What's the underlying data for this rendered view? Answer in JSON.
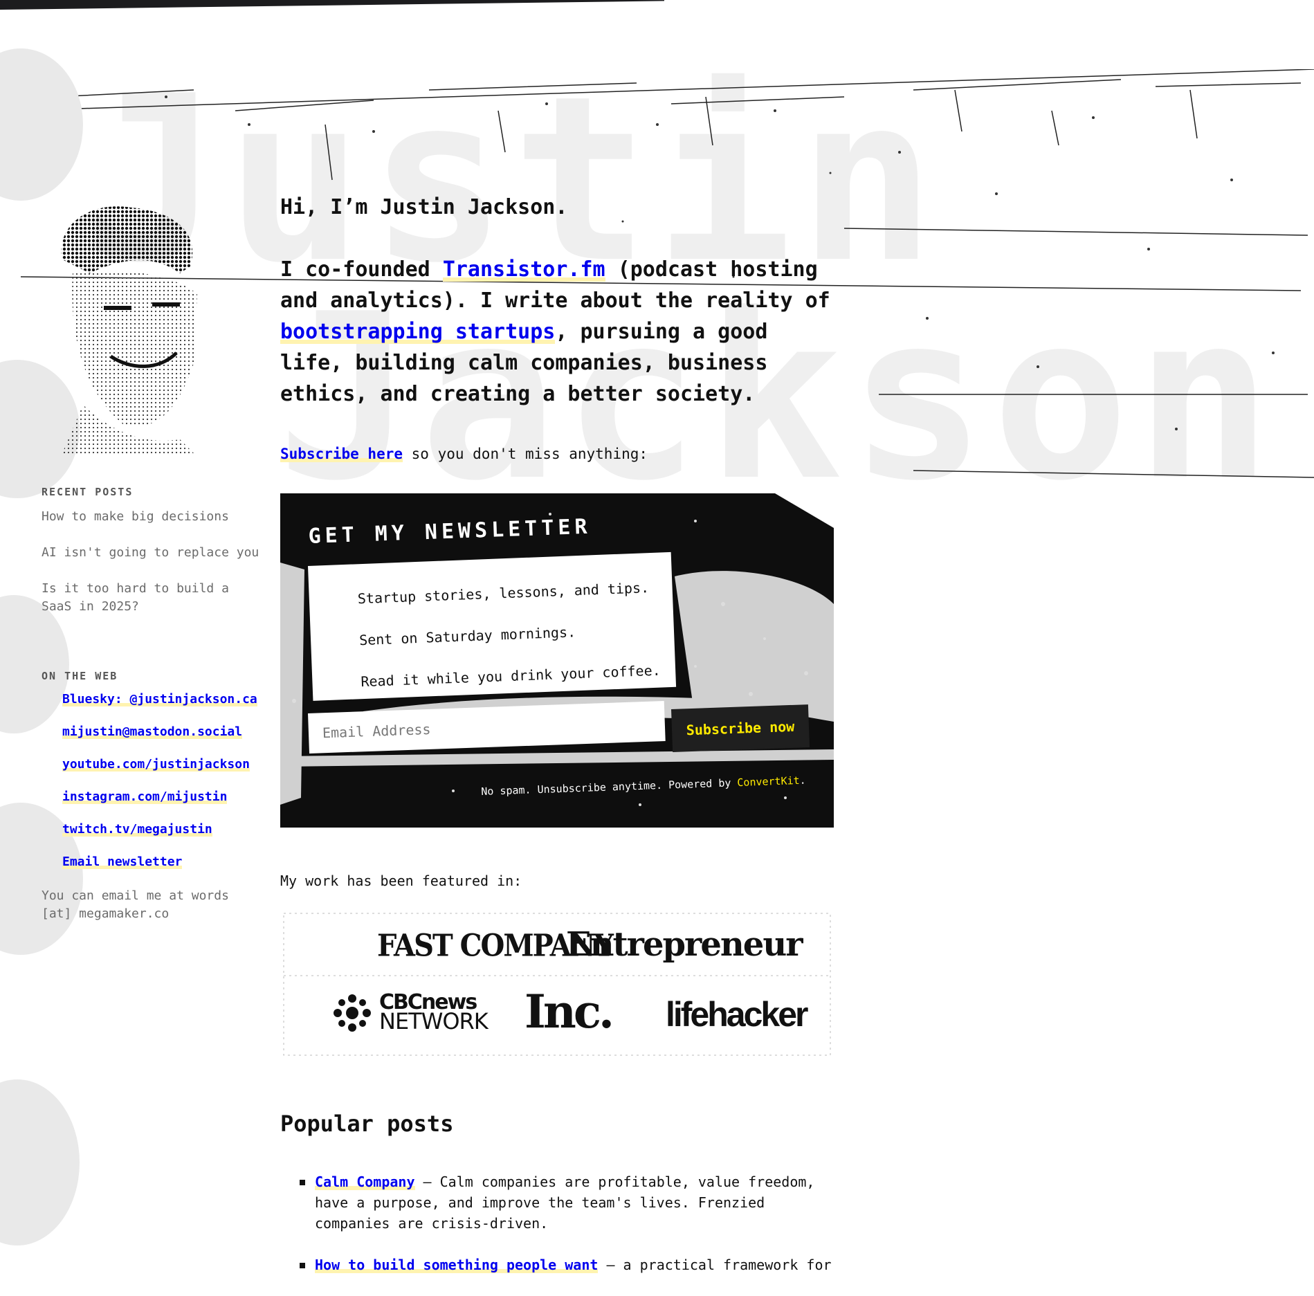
{
  "background_words": [
    "Justin",
    "Jackson"
  ],
  "hero": {
    "greeting": "Hi, I’m Justin Jackson.",
    "intro_prefix": "I co-founded ",
    "transistor_link": "Transistor.fm",
    "intro_middle": " (podcast hosting and analytics). I write about the reality of ",
    "bootstrapping_link": "bootstrapping startups",
    "intro_suffix": ", pursuing a good life, building calm companies, business ethics, and creating a better society."
  },
  "subscribe_line": {
    "link": "Subscribe here",
    "text": " so you don't miss anything:"
  },
  "newsletter": {
    "title": "GET MY NEWSLETTER",
    "lines": [
      "Startup stories, lessons, and tips.",
      "Sent on Saturday mornings.",
      "Read it while you drink your coffee."
    ],
    "email_placeholder": "Email Address",
    "button": "Subscribe now",
    "footer_text": "No spam. Unsubscribe anytime. Powered by ",
    "footer_link": "ConvertKit",
    "footer_end": "."
  },
  "featured": {
    "label": "My work has been featured in:",
    "logos": {
      "fast_company": "FAST COMPANY",
      "entrepreneur": "Entrepreneur",
      "cbc_top": "CBCnews",
      "cbc_bottom": "NETWORK",
      "inc": "Inc.",
      "lifehacker": "lifehacker"
    }
  },
  "popular": {
    "title": "Popular posts",
    "items": [
      {
        "link": "Calm Company",
        "text": " — Calm companies are profitable, value freedom, have a purpose, and improve the team's lives. Frenzied companies are crisis-driven."
      },
      {
        "link": "How to build something people want",
        "text": " — a practical framework for"
      }
    ]
  },
  "sidebar": {
    "recent_heading": "RECENT POSTS",
    "recent_posts": [
      "How to make big decisions",
      "AI isn't going to replace you",
      "Is it too hard to build a SaaS in 2025?"
    ],
    "web_heading": "ON THE WEB",
    "web_links": [
      "Bluesky: @justinjackson.ca",
      "mijustin@mastodon.social",
      "youtube.com/justinjackson",
      "instagram.com/mijustin",
      "twitch.tv/megajustin",
      "Email newsletter"
    ],
    "email_note": "You can email me at words [at] megamaker.co"
  },
  "colors": {
    "link": "#0000ee",
    "highlight": "#fff3b0",
    "accent_yellow": "#ffea00",
    "dark": "#0e0e0e"
  }
}
